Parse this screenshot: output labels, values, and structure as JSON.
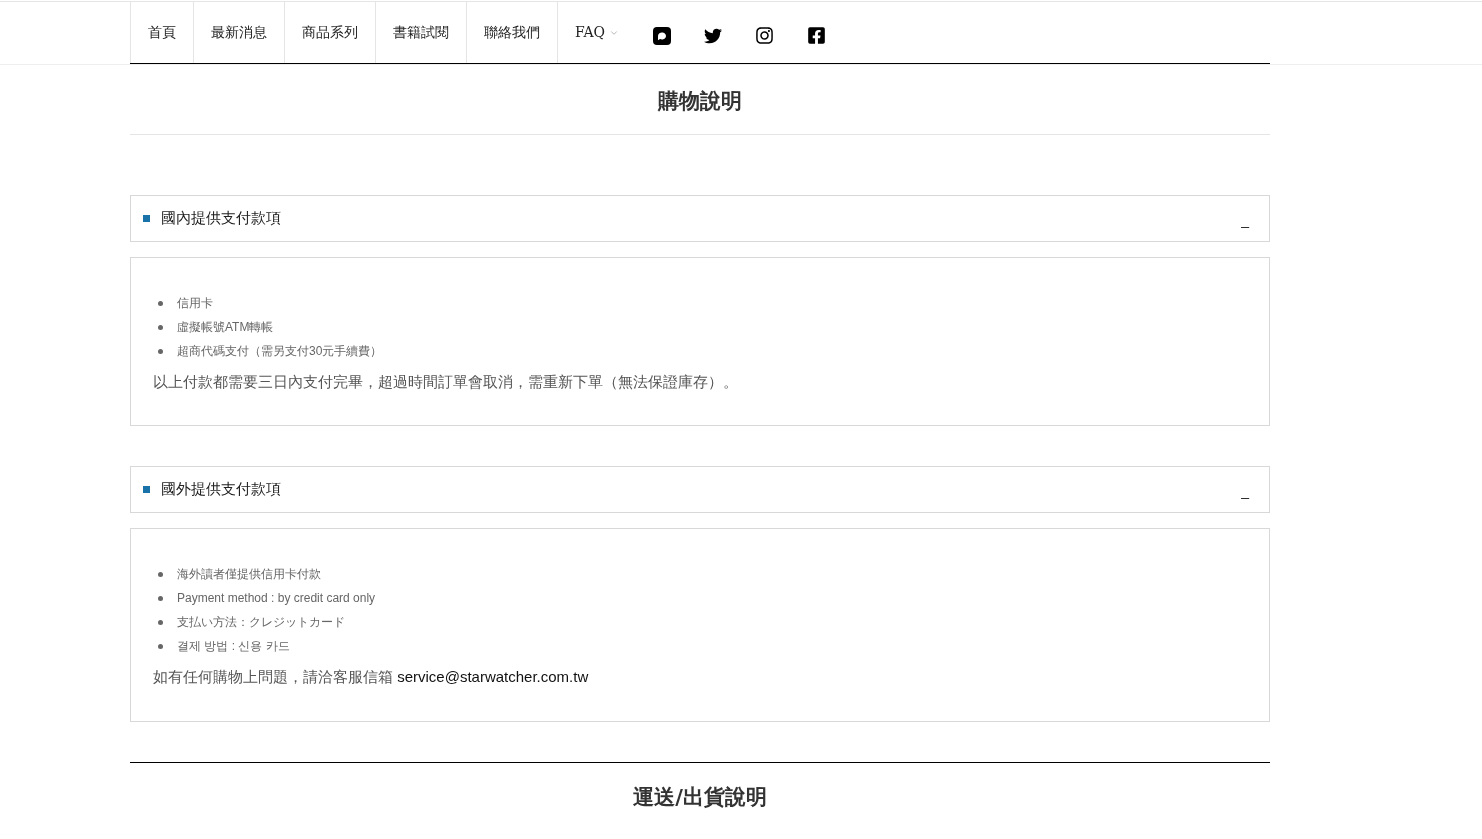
{
  "nav": {
    "items": [
      {
        "label": "首頁",
        "kind": "link"
      },
      {
        "label": "最新消息",
        "kind": "link"
      },
      {
        "label": "商品系列",
        "kind": "link"
      },
      {
        "label": "書籍試閱",
        "kind": "link"
      },
      {
        "label": "聯絡我們",
        "kind": "link"
      },
      {
        "label": "FAQ",
        "kind": "dropdown"
      }
    ]
  },
  "page_title": "購物說明",
  "sections": [
    {
      "title": "國內提供支付款項",
      "toggle": "_",
      "items": [
        "信用卡",
        "虛擬帳號ATM轉帳",
        "超商代碼支付（需另支付30元手續費）"
      ],
      "note": "以上付款都需要三日內支付完畢，超過時間訂單會取消，需重新下單（無法保證庫存）。"
    },
    {
      "title": "國外提供支付款項",
      "toggle": "_",
      "items": [
        "海外讀者僅提供信用卡付款",
        "Payment method : by credit card only",
        "支払い方法：クレジットカード",
        "결제 방법 : 신용 카드"
      ],
      "note": "如有任何購物上問題，請洽客服信箱",
      "email": "service@starwatcher.com.tw"
    }
  ],
  "next_title": "運送/出貨說明"
}
